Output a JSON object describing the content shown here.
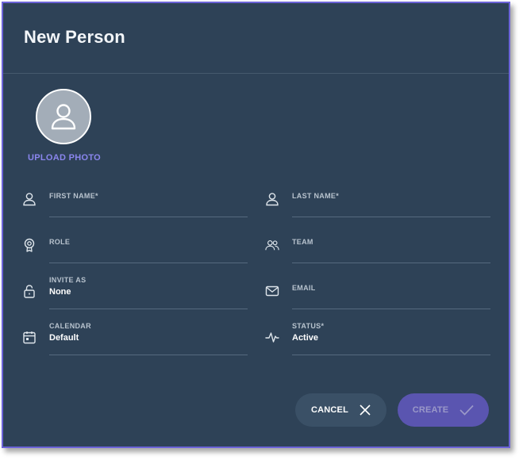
{
  "dialog": {
    "title": "New Person",
    "upload_label": "UPLOAD PHOTO"
  },
  "fields": {
    "first_name": {
      "label": "FIRST NAME*",
      "value": "",
      "icon": "user-icon"
    },
    "last_name": {
      "label": "LAST NAME*",
      "value": "",
      "icon": "user-icon"
    },
    "role": {
      "label": "ROLE",
      "value": "",
      "icon": "role-badge-icon"
    },
    "team": {
      "label": "TEAM",
      "value": "",
      "icon": "team-icon"
    },
    "invite_as": {
      "label": "INVITE AS",
      "value": "None",
      "icon": "lock-icon"
    },
    "email": {
      "label": "EMAIL",
      "value": "",
      "icon": "envelope-icon"
    },
    "calendar": {
      "label": "CALENDAR",
      "value": "Default",
      "icon": "calendar-icon"
    },
    "status": {
      "label": "STATUS*",
      "value": "Active",
      "icon": "activity-icon"
    }
  },
  "actions": {
    "cancel_label": "CANCEL",
    "create_label": "CREATE"
  },
  "colors": {
    "background": "#2e4257",
    "accent": "#8a86ee",
    "border": "#6b63d8",
    "create_button": "#5a55b0",
    "cancel_button": "#3a5066"
  }
}
